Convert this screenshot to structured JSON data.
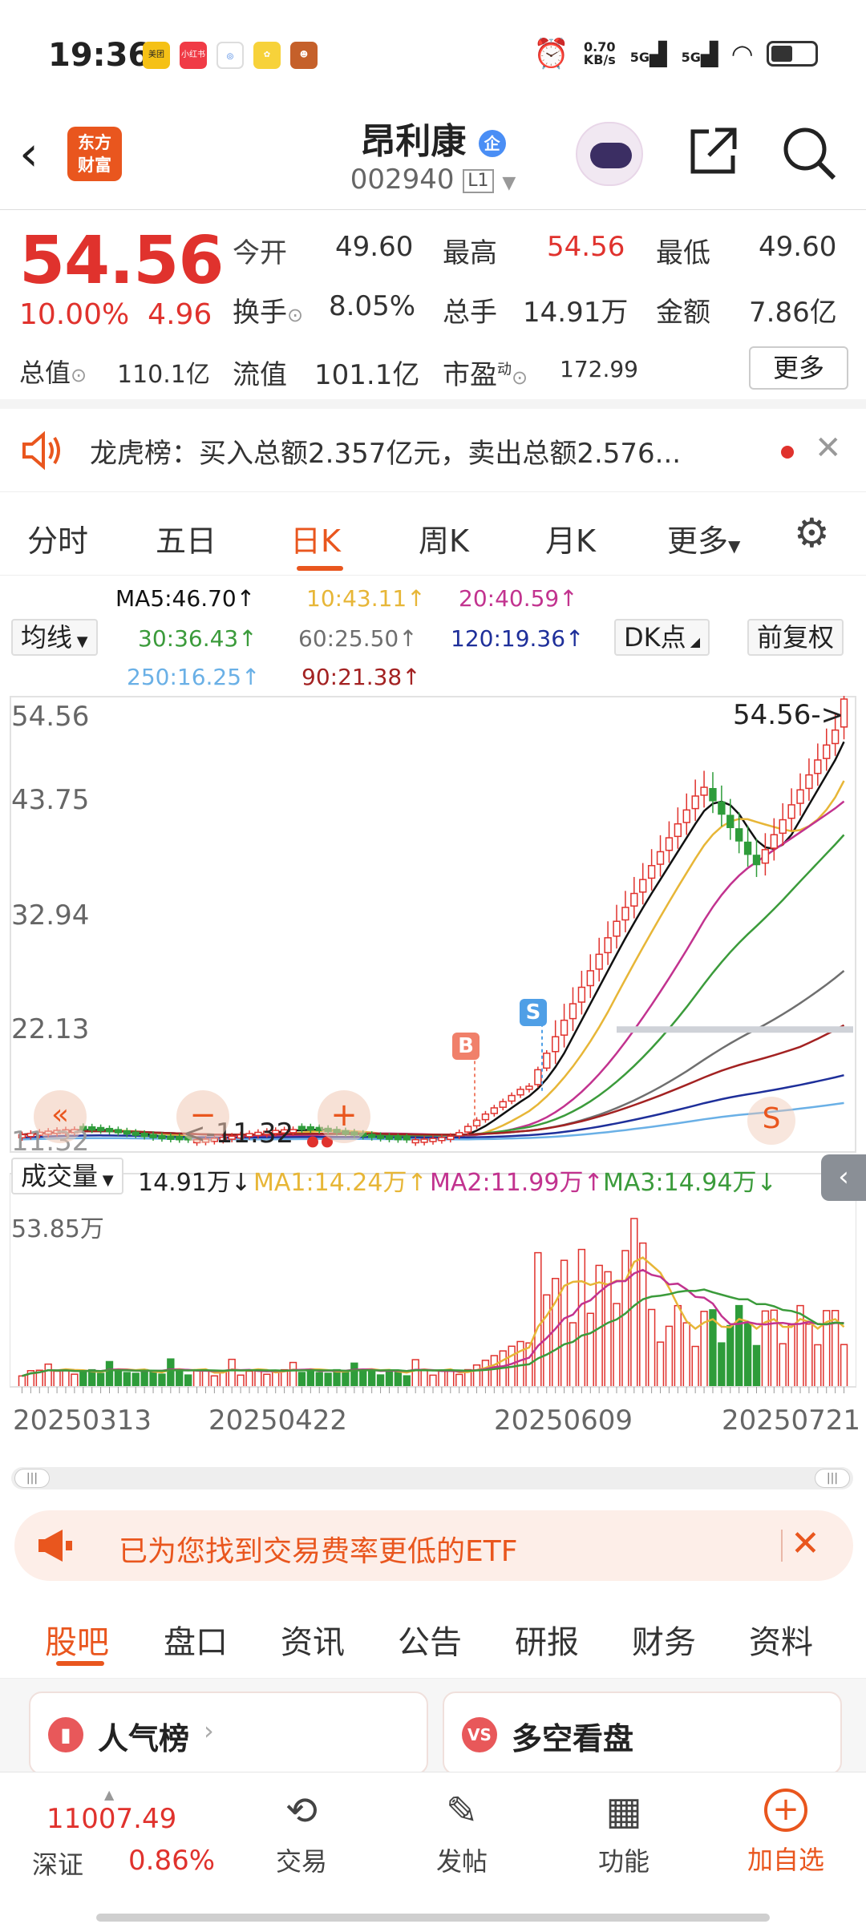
{
  "status": {
    "time": "19:36",
    "net_speed": "0.70\nKB/s",
    "sig1": "5G",
    "sig2": "5G"
  },
  "header": {
    "name": "昂利康",
    "badge": "企",
    "code": "002940",
    "level": "L1",
    "logo": "东方\n财富"
  },
  "quote": {
    "price": "54.56",
    "pct": "10.00%",
    "chg": "4.96",
    "open_label": "今开",
    "open": "49.60",
    "high_label": "最高",
    "high": "54.56",
    "low_label": "最低",
    "low": "49.60",
    "turnover_label": "换手",
    "turnover": "8.05%",
    "volume_label": "总手",
    "volume": "14.91万",
    "amount_label": "金额",
    "amount": "7.86亿",
    "mcap_label": "总值",
    "mcap": "110.1亿",
    "float_label": "流值",
    "float": "101.1亿",
    "pe_label": "市盈",
    "pe_sup": "动",
    "pe": "172.99",
    "more": "更多"
  },
  "notice": {
    "text": "龙虎榜：买入总额2.357亿元，卖出总额2.576..."
  },
  "period_tabs": [
    "分时",
    "五日",
    "日K",
    "周K",
    "月K",
    "更多"
  ],
  "ma_legend": {
    "selector": "均线",
    "ma5": "MA5:46.70↑",
    "ma10": "10:43.11↑",
    "ma20": "20:40.59↑",
    "ma30": "30:36.43↑",
    "ma60": "60:25.50↑",
    "ma120": "120:19.36↑",
    "ma250": "250:16.25↑",
    "ma90": "90:21.38↑",
    "dk": "DK点",
    "adjust": "前复权"
  },
  "colors": {
    "up": "#e0322d",
    "down": "#2e9c3a",
    "accent": "#e9561e",
    "ma5": "#111111",
    "ma10": "#e7b637",
    "ma20": "#c2338f",
    "ma30": "#3b9b3b",
    "ma60": "#6f6f6f",
    "ma120": "#1e2f9a",
    "ma250": "#6ab0e6",
    "ma90": "#a32222"
  },
  "chart_data": {
    "type": "candlestick",
    "y_axis_labels": [
      "54.56",
      "43.75",
      "32.94",
      "22.13",
      "11.32"
    ],
    "last_price_marker": "54.56->",
    "low_marker": "<-11.32",
    "buy_marker": "B",
    "sell_marker": "S",
    "x_labels": [
      "20250313",
      "20250422",
      "20250609",
      "20250721"
    ],
    "volume_label": "成交量",
    "volume_value": "14.91万↓",
    "vol_ma1": "MA1:14.24万↑",
    "vol_ma2": "MA2:11.99万↑",
    "vol_ma3": "MA3:14.94万↓",
    "volume_max": "53.85万"
  },
  "etf_banner": {
    "text": "已为您找到交易费率更低的ETF"
  },
  "bottom_tabs": [
    "股吧",
    "盘口",
    "资讯",
    "公告",
    "研报",
    "财务",
    "资料"
  ],
  "cards": {
    "left": "人气榜",
    "right": "多空看盘"
  },
  "bottom_nav": {
    "index_value": "11007.49",
    "index_name": "深证",
    "index_pct": "0.86%",
    "trade": "交易",
    "post": "发帖",
    "func": "功能",
    "watch": "加自选"
  }
}
